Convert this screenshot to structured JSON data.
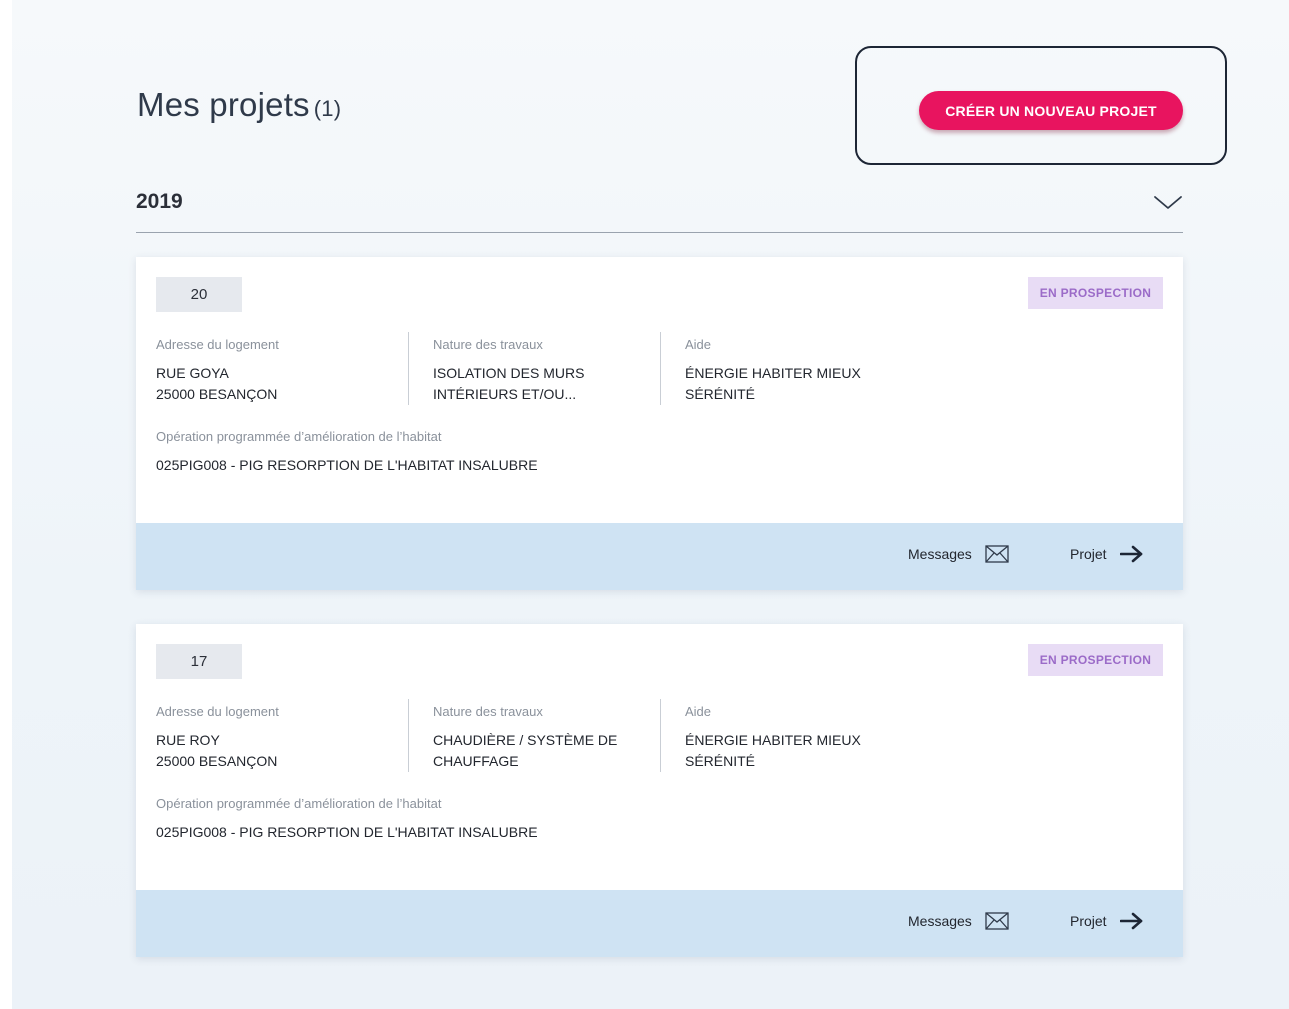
{
  "header": {
    "title": "Mes projets",
    "count": "(1)",
    "cta_label": "CRÉER UN NOUVEAU PROJET"
  },
  "group": {
    "year": "2019",
    "chevron_icon": "chevron-down-icon"
  },
  "labels": {
    "address": "Adresse du logement",
    "works": "Nature des travaux",
    "aid": "Aide",
    "operation": "Opération programmée d’amélioration de l’habitat",
    "messages": "Messages",
    "project": "Projet"
  },
  "icons": {
    "messages": "envelope-icon",
    "project": "arrow-right-icon"
  },
  "colors": {
    "cta": "#e8145f",
    "badge_bg": "#e8dcf5",
    "badge_text": "#9b6bc8",
    "footer_bg": "#cfe3f3"
  },
  "projects": [
    {
      "id": "20",
      "status": "EN PROSPECTION",
      "address_line1": "RUE GOYA",
      "address_line2": "25000 BESANÇON",
      "works_line1": "ISOLATION DES MURS",
      "works_line2": "INTÉRIEURS ET/OU...",
      "aid_line1": "ÉNERGIE HABITER MIEUX",
      "aid_line2": "SÉRÉNITÉ",
      "operation": "025PIG008 - PIG RESORPTION DE L'HABITAT INSALUBRE"
    },
    {
      "id": "17",
      "status": "EN PROSPECTION",
      "address_line1": "RUE ROY",
      "address_line2": "25000 BESANÇON",
      "works_line1": "CHAUDIÈRE / SYSTÈME DE",
      "works_line2": "CHAUFFAGE",
      "aid_line1": "ÉNERGIE HABITER MIEUX",
      "aid_line2": "SÉRÉNITÉ",
      "operation": "025PIG008 - PIG RESORPTION DE L'HABITAT INSALUBRE"
    }
  ]
}
